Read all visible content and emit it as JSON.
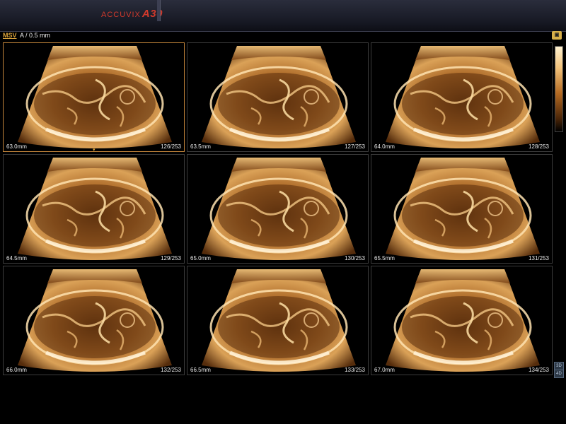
{
  "header": {
    "brand_prefix": "ACCUVIX",
    "brand_model": "A30"
  },
  "mode": {
    "label": "MSV",
    "slice_info": "A / 0.5 mm"
  },
  "icons": {
    "corner": "3d-render-icon",
    "side_top": "3d-icon",
    "side_bottom": "4d-icon"
  },
  "side_icons": {
    "top": "3D",
    "bottom": "4D"
  },
  "colors": {
    "accent": "#c2843a",
    "tissue": "#e0a050"
  },
  "slices": [
    {
      "depth": "63.0mm",
      "frame": "126/253"
    },
    {
      "depth": "63.5mm",
      "frame": "127/253"
    },
    {
      "depth": "64.0mm",
      "frame": "128/253"
    },
    {
      "depth": "64.5mm",
      "frame": "129/253"
    },
    {
      "depth": "65.0mm",
      "frame": "130/253"
    },
    {
      "depth": "65.5mm",
      "frame": "131/253"
    },
    {
      "depth": "66.0mm",
      "frame": "132/253"
    },
    {
      "depth": "66.5mm",
      "frame": "133/253"
    },
    {
      "depth": "67.0mm",
      "frame": "134/253"
    }
  ]
}
